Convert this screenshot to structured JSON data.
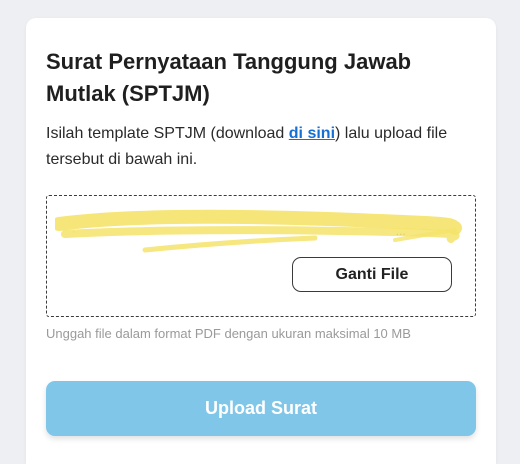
{
  "form": {
    "title": "Surat Pernyataan Tanggung Jawab Mutlak (SPTJM)",
    "instruction_before_link": "Isilah template SPTJM (download ",
    "download_link_label": "di sini",
    "instruction_after_link": ") lalu upload file tersebut di bawah ini.",
    "file_name_visible_suffix": "...",
    "change_file_label": "Ganti File",
    "hint": "Unggah file dalam format PDF dengan ukuran maksimal 10 MB",
    "upload_label": "Upload Surat"
  },
  "colors": {
    "link": "#1570d6",
    "upload_button_bg": "#7fc6e9",
    "redaction_marker": "#f5e36a"
  }
}
